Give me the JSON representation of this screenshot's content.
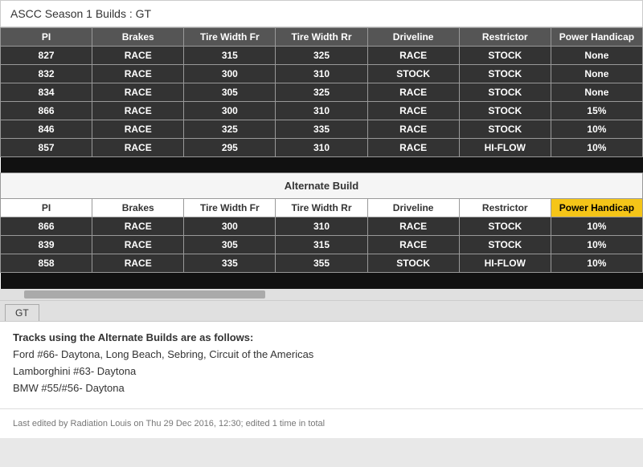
{
  "title": "ASCC Season 1 Builds : GT",
  "main_table": {
    "headers": [
      "PI",
      "Brakes",
      "Tire Width Fr",
      "Tire Width Rr",
      "Driveline",
      "Restrictor",
      "Power Handicap"
    ],
    "rows": [
      {
        "pi": "827",
        "brakes": "RACE",
        "tw_fr": "315",
        "tw_rr": "325",
        "driveline": "RACE",
        "restrictor": "STOCK",
        "handicap": "None"
      },
      {
        "pi": "832",
        "brakes": "RACE",
        "tw_fr": "300",
        "tw_rr": "310",
        "driveline": "STOCK",
        "restrictor": "STOCK",
        "handicap": "None"
      },
      {
        "pi": "834",
        "brakes": "RACE",
        "tw_fr": "305",
        "tw_rr": "325",
        "driveline": "RACE",
        "restrictor": "STOCK",
        "handicap": "None"
      },
      {
        "pi": "866",
        "brakes": "RACE",
        "tw_fr": "300",
        "tw_rr": "310",
        "driveline": "RACE",
        "restrictor": "STOCK",
        "handicap": "15%"
      },
      {
        "pi": "846",
        "brakes": "RACE",
        "tw_fr": "325",
        "tw_rr": "335",
        "driveline": "RACE",
        "restrictor": "STOCK",
        "handicap": "10%"
      },
      {
        "pi": "857",
        "brakes": "RACE",
        "tw_fr": "295",
        "tw_rr": "310",
        "driveline": "RACE",
        "restrictor": "HI-FLOW",
        "handicap": "10%"
      }
    ]
  },
  "alternate_build": {
    "section_title": "Alternate Build",
    "headers": [
      "PI",
      "Brakes",
      "Tire Width Fr",
      "Tire Width Rr",
      "Driveline",
      "Restrictor",
      "Power Handicap"
    ],
    "rows": [
      {
        "pi": "866",
        "brakes": "RACE",
        "tw_fr": "300",
        "tw_rr": "310",
        "driveline": "RACE",
        "restrictor": "STOCK",
        "handicap": "10%"
      },
      {
        "pi": "839",
        "brakes": "RACE",
        "tw_fr": "305",
        "tw_rr": "315",
        "driveline": "RACE",
        "restrictor": "STOCK",
        "handicap": "10%"
      },
      {
        "pi": "858",
        "brakes": "RACE",
        "tw_fr": "335",
        "tw_rr": "355",
        "driveline": "STOCK",
        "restrictor": "HI-FLOW",
        "handicap": "10%"
      }
    ]
  },
  "tab": "GT",
  "content": {
    "bold_line": "Tracks using the Alternate Builds are as follows:",
    "lines": [
      "Ford #66- Daytona, Long Beach, Sebring, Circuit of the Americas",
      "Lamborghini #63- Daytona",
      "BMW #55/#56- Daytona"
    ]
  },
  "footer": "Last edited by Radiation Louis on Thu 29 Dec 2016, 12:30; edited 1 time in total"
}
